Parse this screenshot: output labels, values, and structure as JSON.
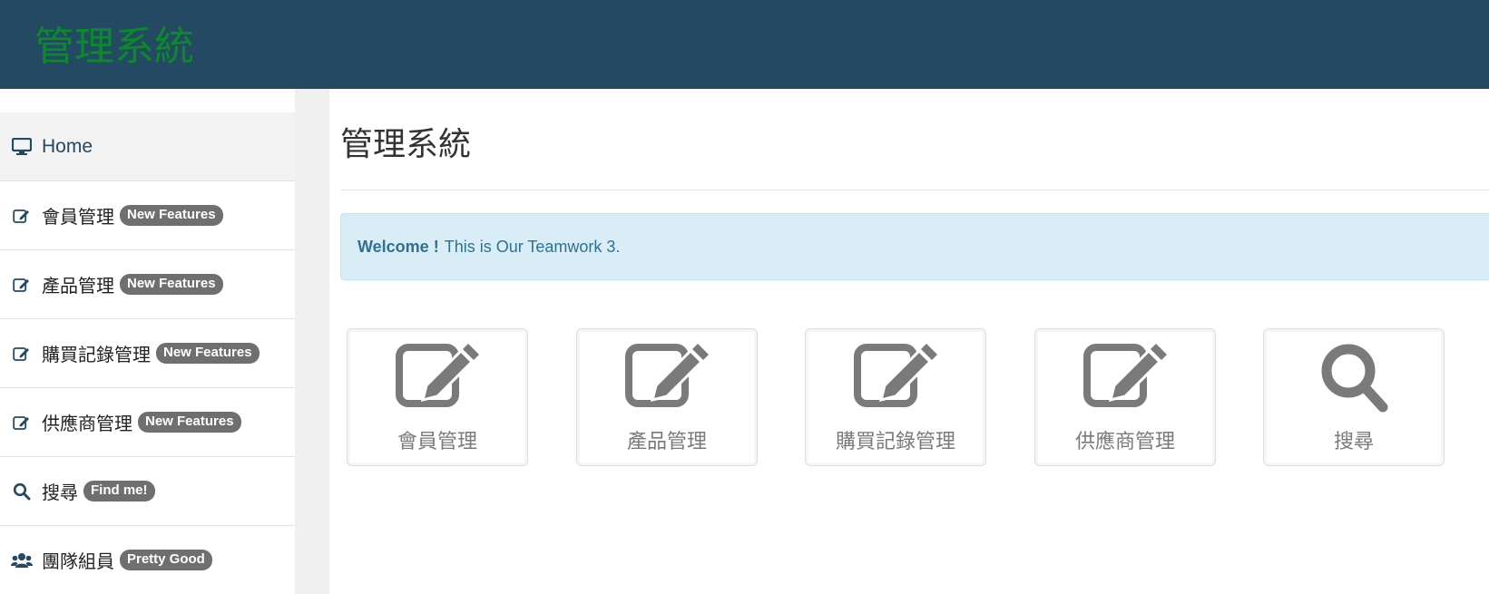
{
  "header": {
    "brand": "管理系統"
  },
  "sidebar": {
    "items": [
      {
        "label": "Home",
        "icon": "monitor-icon",
        "badge": null
      },
      {
        "label": "會員管理",
        "icon": "edit-icon",
        "badge": "New Features"
      },
      {
        "label": "產品管理",
        "icon": "edit-icon",
        "badge": "New Features"
      },
      {
        "label": "購買記錄管理",
        "icon": "edit-icon",
        "badge": "New Features"
      },
      {
        "label": "供應商管理",
        "icon": "edit-icon",
        "badge": "New Features"
      },
      {
        "label": "搜尋",
        "icon": "search-icon",
        "badge": "Find me!"
      },
      {
        "label": "團隊組員",
        "icon": "users-icon",
        "badge": "Pretty Good"
      }
    ]
  },
  "main": {
    "title": "管理系統",
    "alert": {
      "strong": "Welcome !",
      "text": "This is Our Teamwork 3."
    },
    "tiles": [
      {
        "label": "會員管理",
        "icon": "edit-icon"
      },
      {
        "label": "產品管理",
        "icon": "edit-icon"
      },
      {
        "label": "購買記錄管理",
        "icon": "edit-icon"
      },
      {
        "label": "供應商管理",
        "icon": "edit-icon"
      },
      {
        "label": "搜尋",
        "icon": "search-icon"
      }
    ]
  },
  "colors": {
    "topbar": "#244963",
    "brand": "#0a8a2a",
    "badge": "#6f6f6f",
    "alert_bg": "#d9edf7",
    "alert_text": "#31708f",
    "tile_icon": "#7a7a7a"
  }
}
